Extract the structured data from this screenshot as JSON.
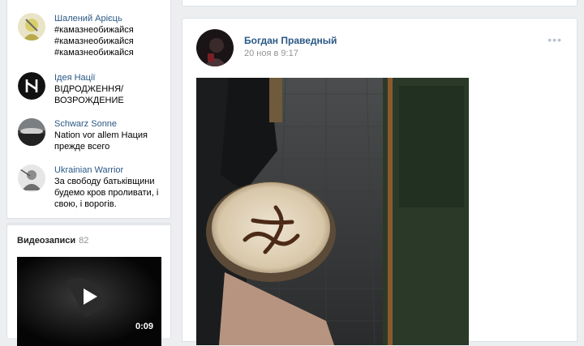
{
  "groups": [
    {
      "name": "Шалений Арієць",
      "desc": [
        "#камазнеобижайся",
        "#камазнеобижайся",
        "#камазнеобижайся"
      ]
    },
    {
      "name": "Ідея Нації",
      "desc": [
        "ВІДРОДЖЕННЯ/",
        "ВОЗРОЖДЕНИЕ"
      ]
    },
    {
      "name": "Schwarz Sonne",
      "desc": [
        "Nation vor allem Нация",
        "прежде всего"
      ]
    },
    {
      "name": "Ukrainian Warrior",
      "desc": [
        "За свободу батьківщини",
        "будемо кров проливати, і",
        "свою, і ворогів."
      ]
    }
  ],
  "videos": {
    "title": "Видеозаписи",
    "count": "82",
    "duration": "0:09"
  },
  "post": {
    "author": "Богдан Праведный",
    "time": "20 ноя в 9:17",
    "menu": "•••"
  },
  "colors": {
    "link": "#2a5885",
    "background": "#edeef0",
    "muted": "#939393"
  },
  "icons": [
    "play-icon",
    "more-icon"
  ]
}
